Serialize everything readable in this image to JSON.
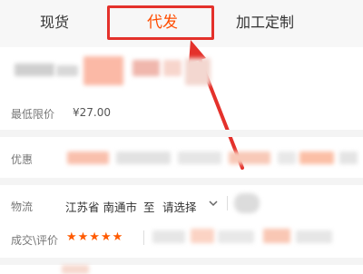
{
  "tabs": {
    "xianhuo": "现货",
    "daifa": "代发",
    "jiagong": "加工定制"
  },
  "price_row": {
    "label": "最低限价",
    "value": "¥27.00"
  },
  "promo_row": {
    "label": "优惠"
  },
  "logistics_row": {
    "label": "物流",
    "origin": "江苏省 南通市",
    "to": "至",
    "select": "请选择"
  },
  "review_row": {
    "label": "成交\\评价",
    "stars": "★★★★★"
  },
  "colors": {
    "accent": "#ff4d00",
    "annotation": "#e4312b",
    "star": "#ff5a00"
  },
  "icons": {
    "dropdown": "chevron-down-icon"
  }
}
